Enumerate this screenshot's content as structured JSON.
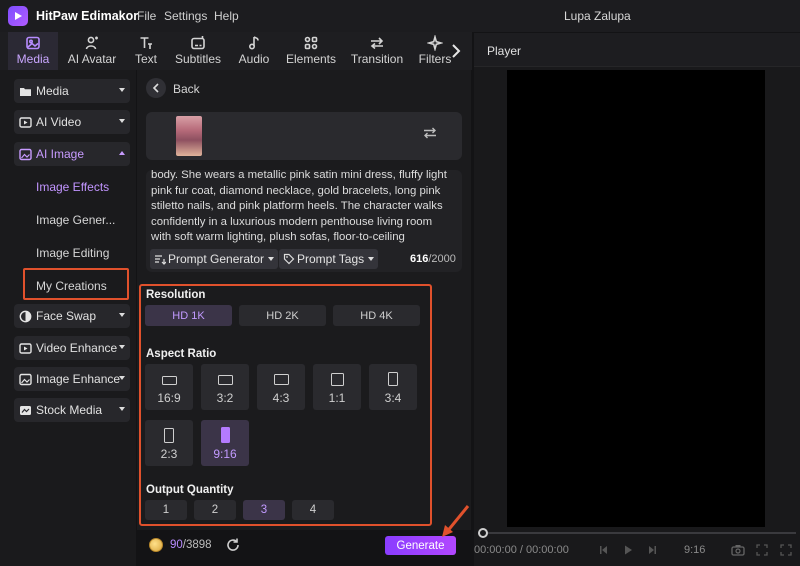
{
  "app": {
    "name": "HitPaw Edimakor",
    "menu": [
      "File",
      "Settings",
      "Help"
    ],
    "project_name": "Lupa Zalupa"
  },
  "toolbar": {
    "tabs": [
      {
        "label": "Media",
        "icon": "media-icon",
        "active": true
      },
      {
        "label": "AI Avatar",
        "icon": "ai-avatar-icon",
        "active": false
      },
      {
        "label": "Text",
        "icon": "text-icon",
        "active": false
      },
      {
        "label": "Subtitles",
        "icon": "subtitles-icon",
        "active": false
      },
      {
        "label": "Audio",
        "icon": "audio-icon",
        "active": false
      },
      {
        "label": "Elements",
        "icon": "elements-icon",
        "active": false
      },
      {
        "label": "Transition",
        "icon": "transition-icon",
        "active": false
      },
      {
        "label": "Filters",
        "icon": "filters-icon",
        "active": false
      }
    ]
  },
  "sidebar": {
    "items": [
      {
        "label": "Media",
        "icon": "folder-icon"
      },
      {
        "label": "AI Video",
        "icon": "ai-video-icon"
      },
      {
        "label": "AI Image",
        "icon": "ai-image-icon",
        "expanded": true
      },
      {
        "label": "Face Swap",
        "icon": "face-swap-icon"
      },
      {
        "label": "Video Enhance",
        "icon": "video-enhance-icon"
      },
      {
        "label": "Image Enhance",
        "icon": "image-enhance-icon"
      },
      {
        "label": "Stock Media",
        "icon": "stock-media-icon"
      }
    ],
    "ai_image_sub": [
      "Image Effects",
      "Image Gener...",
      "Image Editing",
      "My Creations"
    ]
  },
  "panel": {
    "back_label": "Back",
    "prompt_lines": [
      "body. She wears a metallic pink satin mini dress, fluffy light",
      "pink fur coat, diamond necklace, gold bracelets, long pink",
      "stiletto nails, and pink platform heels. The character walks",
      "confidently in a luxurious modern penthouse living room",
      "with soft warm lighting, plush sofas, floor-to-ceiling"
    ],
    "prompt_generator_label": "Prompt Generator",
    "prompt_tags_label": "Prompt Tags",
    "char_count": "616",
    "char_max": "/2000",
    "resolution_title": "Resolution",
    "resolutions": [
      "HD 1K",
      "HD 2K",
      "HD 4K"
    ],
    "resolution_selected": "HD 1K",
    "aspect_title": "Aspect Ratio",
    "aspects": [
      "16:9",
      "3:2",
      "4:3",
      "1:1",
      "3:4",
      "2:3",
      "9:16"
    ],
    "aspect_selected": "9:16",
    "quantity_title": "Output Quantity",
    "quantities": [
      "1",
      "2",
      "3",
      "4"
    ],
    "quantity_selected": "3",
    "credits_used": "90",
    "credits_total": "/3898",
    "generate_label": "Generate"
  },
  "player": {
    "title": "Player",
    "time": "00:00:00 / 00:00:00",
    "ratio": "9:16"
  },
  "colors": {
    "accent": "#b47bff",
    "highlight_border": "#e0512c",
    "generate": "#9b42ff"
  }
}
